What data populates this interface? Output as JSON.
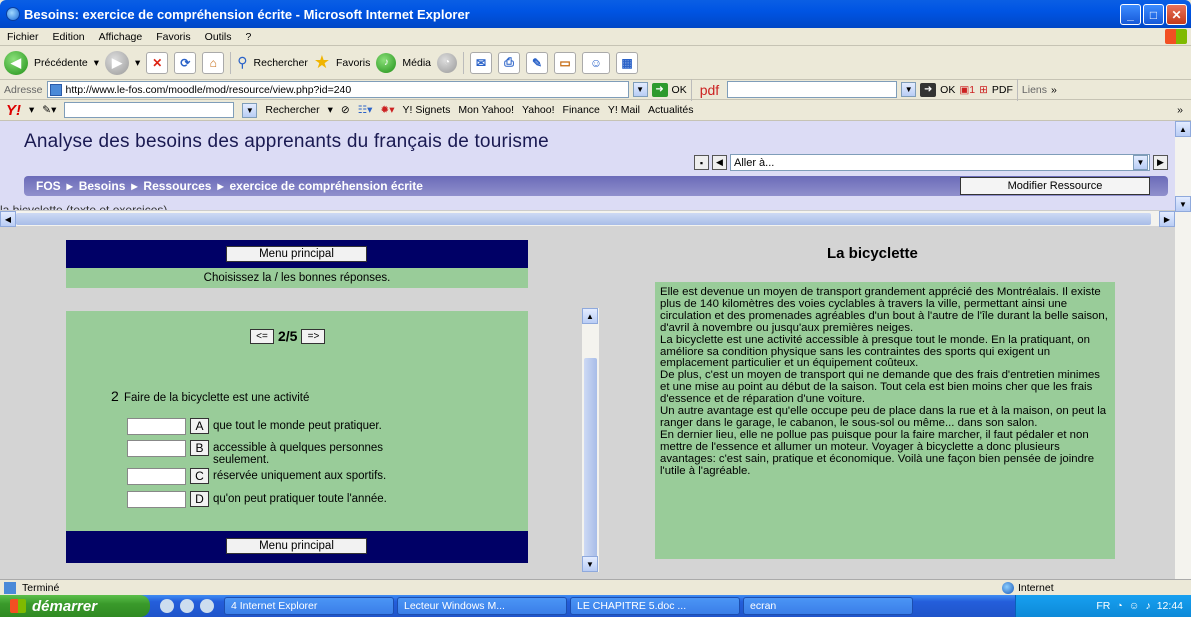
{
  "window": {
    "title": "Besoins: exercice de compréhension écrite - Microsoft Internet Explorer"
  },
  "menubar": {
    "items": [
      "Fichier",
      "Edition",
      "Affichage",
      "Favoris",
      "Outils",
      "?"
    ]
  },
  "toolbar": {
    "back": "Précédente",
    "search": "Rechercher",
    "favorites": "Favoris",
    "media": "Média"
  },
  "address": {
    "label": "Adresse",
    "url": "http://www.le-fos.com/moodle/mod/resource/view.php?id=240",
    "go": "OK",
    "pdf_label": "pdf",
    "ok2": "OK",
    "pdf_btn": "PDF",
    "liens": "Liens"
  },
  "yahoo": {
    "search": "Rechercher",
    "signets": "Y! Signets",
    "mon": "Mon Yahoo!",
    "yahoo": "Yahoo!",
    "finance": "Finance",
    "mail": "Y! Mail",
    "actus": "Actualités"
  },
  "moodle": {
    "title": "Analyse des besoins des apprenants du français de tourisme",
    "jump_placeholder": "Aller à...",
    "breadcrumb": [
      "FOS",
      "Besoins",
      "Ressources",
      "exercice de compréhension écrite"
    ],
    "edit_button": "Modifier Ressource",
    "resource_line": "la bicyclette (texte et exercices)"
  },
  "exercise": {
    "menu_button": "Menu principal",
    "instruction": "Choisissez la / les bonnes réponses.",
    "prev": "<=",
    "next": "=>",
    "page": "2/5",
    "q_num": "2",
    "question": "Faire de la bicyclette est une activité",
    "answers": [
      {
        "letter": "A",
        "text": "que tout le monde peut pratiquer."
      },
      {
        "letter": "B",
        "text": "accessible à quelques personnes seulement."
      },
      {
        "letter": "C",
        "text": "réservée uniquement aux sportifs."
      },
      {
        "letter": "D",
        "text": "qu'on peut pratiquer toute l'année."
      }
    ]
  },
  "reading": {
    "title": "La bicyclette",
    "text": "Elle est devenue un moyen de transport grandement apprécié des Montréalais. Il existe plus de 140 kilomètres des voies cyclables à travers la ville, permettant ainsi une circulation et des promenades agréables d'un bout à l'autre de l'île durant la belle saison, d'avril à novembre ou jusqu'aux premières neiges.\nLa bicyclette est une activité accessible à presque tout le monde. En la pratiquant, on améliore sa condition physique sans les contraintes des sports qui exigent un emplacement particulier et un équipement coûteux.\nDe plus, c'est un moyen de transport qui ne demande que des frais d'entretien minimes et une mise au point au début de la saison. Tout cela est bien moins cher que les frais d'essence et de réparation d'une voiture.\nUn autre avantage est qu'elle occupe peu de place dans la rue et à la maison, on peut la ranger dans le garage, le cabanon, le sous-sol ou même... dans son salon.\nEn dernier lieu, elle ne pollue pas puisque pour la faire marcher, il faut pédaler et non mettre de l'essence et allumer un moteur. Voyager à bicyclette a donc plusieurs avantages: c'est sain, pratique et économique. Voilà une façon bien pensée de joindre l'utile à l'agréable."
  },
  "status": {
    "left": "Terminé",
    "zone": "Internet"
  },
  "taskbar": {
    "start": "démarrer",
    "tasks": [
      "4 Internet Explorer",
      "Lecteur Windows M...",
      "LE CHAPITRE 5.doc ...",
      "ecran"
    ],
    "lang": "FR",
    "clock": "12:44"
  }
}
